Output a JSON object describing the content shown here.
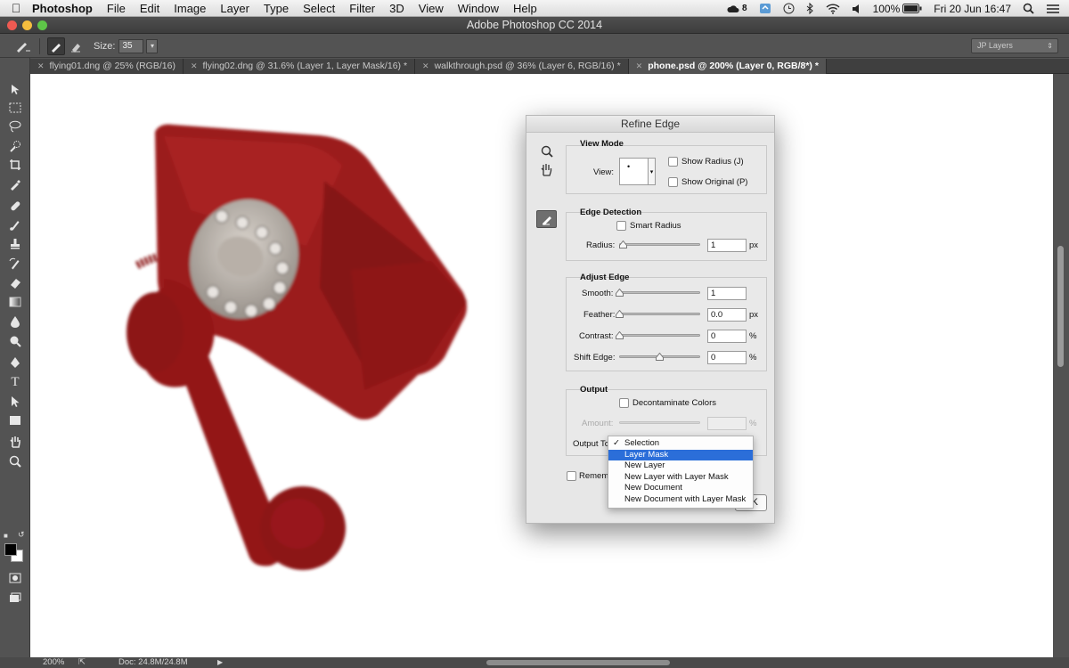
{
  "menubar": {
    "app_name": "Photoshop",
    "items": [
      "File",
      "Edit",
      "Image",
      "Layer",
      "Type",
      "Select",
      "Filter",
      "3D",
      "View",
      "Window",
      "Help"
    ],
    "status": {
      "cc_count": "8",
      "battery": "100%",
      "datetime": "Fri 20 Jun  16:47"
    }
  },
  "window": {
    "title": "Adobe Photoshop CC 2014"
  },
  "options_bar": {
    "size_label": "Size:",
    "size_value": "35",
    "workspace": "JP Layers"
  },
  "tabs": [
    {
      "label": "flying01.dng @ 25% (RGB/16)",
      "active": false
    },
    {
      "label": "flying02.dng @ 31.6% (Layer 1, Layer Mask/16) *",
      "active": false
    },
    {
      "label": "walkthrough.psd @ 36% (Layer 6, RGB/16) *",
      "active": false
    },
    {
      "label": "phone.psd @ 200% (Layer 0, RGB/8*) *",
      "active": true
    }
  ],
  "dialog": {
    "title": "Refine Edge",
    "view_mode": {
      "title": "View Mode",
      "view_label": "View:",
      "show_radius": "Show Radius (J)",
      "show_original": "Show Original (P)"
    },
    "edge_detection": {
      "title": "Edge Detection",
      "smart_radius": "Smart Radius",
      "radius_label": "Radius:",
      "radius_value": "1",
      "radius_unit": "px"
    },
    "adjust_edge": {
      "title": "Adjust Edge",
      "smooth_label": "Smooth:",
      "smooth_value": "1",
      "feather_label": "Feather:",
      "feather_value": "0.0",
      "feather_unit": "px",
      "contrast_label": "Contrast:",
      "contrast_value": "0",
      "contrast_unit": "%",
      "shift_label": "Shift Edge:",
      "shift_value": "0",
      "shift_unit": "%"
    },
    "output": {
      "title": "Output",
      "decontaminate": "Decontaminate Colors",
      "amount_label": "Amount:",
      "amount_unit": "%",
      "output_to_label": "Output To",
      "remember_label": "Rememb",
      "ok_fragment": "K"
    },
    "output_menu": {
      "checked": "Selection",
      "highlighted": "Layer Mask",
      "options": [
        "Selection",
        "Layer Mask",
        "New Layer",
        "New Layer with Layer Mask",
        "New Document",
        "New Document with Layer Mask"
      ]
    }
  },
  "status_bar": {
    "zoom": "200%",
    "doc": "Doc: 24.8M/24.8M"
  },
  "colors": {
    "phone_red": "#9b1a1c",
    "menu_highlight": "#2b6ed9",
    "ui_gray": "#535353"
  }
}
